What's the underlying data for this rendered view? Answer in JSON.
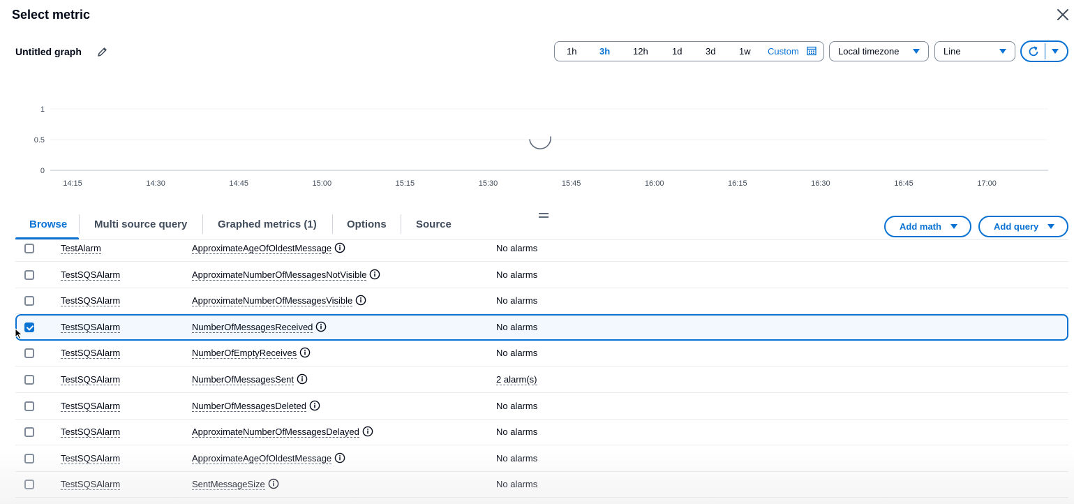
{
  "modal": {
    "title": "Select metric"
  },
  "graph": {
    "title": "Untitled graph"
  },
  "time_ranges": [
    {
      "label": "1h",
      "active": false
    },
    {
      "label": "3h",
      "active": true
    },
    {
      "label": "12h",
      "active": false
    },
    {
      "label": "1d",
      "active": false
    },
    {
      "label": "3d",
      "active": false
    },
    {
      "label": "1w",
      "active": false
    },
    {
      "label": "Custom",
      "active": false
    }
  ],
  "timezone_select": {
    "value": "Local timezone"
  },
  "graph_type_select": {
    "value": "Line"
  },
  "chart_data": {
    "type": "line",
    "y_ticks": [
      "1",
      "0.5",
      "0"
    ],
    "x_ticks": [
      "14:15",
      "14:30",
      "14:45",
      "15:00",
      "15:15",
      "15:30",
      "15:45",
      "16:00",
      "16:15",
      "16:30",
      "16:45",
      "17:00"
    ],
    "ylim": [
      0,
      1
    ],
    "series": [],
    "loading": true,
    "grid": true
  },
  "tabs": [
    {
      "label": "Browse",
      "active": true
    },
    {
      "label": "Multi source query",
      "active": false
    },
    {
      "label": "Graphed metrics (1)",
      "active": false
    },
    {
      "label": "Options",
      "active": false
    },
    {
      "label": "Source",
      "active": false
    }
  ],
  "actions": {
    "add_math": "Add math",
    "add_query": "Add query"
  },
  "rows": [
    {
      "name": "TestAlarm",
      "metric": "ApproximateAgeOfOldestMessage",
      "alarms": "No alarms",
      "checked": false
    },
    {
      "name": "TestSQSAlarm",
      "metric": "ApproximateNumberOfMessagesNotVisible",
      "alarms": "No alarms",
      "checked": false
    },
    {
      "name": "TestSQSAlarm",
      "metric": "ApproximateNumberOfMessagesVisible",
      "alarms": "No alarms",
      "checked": false
    },
    {
      "name": "TestSQSAlarm",
      "metric": "NumberOfMessagesReceived",
      "alarms": "No alarms",
      "checked": true
    },
    {
      "name": "TestSQSAlarm",
      "metric": "NumberOfEmptyReceives",
      "alarms": "No alarms",
      "checked": false
    },
    {
      "name": "TestSQSAlarm",
      "metric": "NumberOfMessagesSent",
      "alarms": "2 alarm(s)",
      "checked": false
    },
    {
      "name": "TestSQSAlarm",
      "metric": "NumberOfMessagesDeleted",
      "alarms": "No alarms",
      "checked": false
    },
    {
      "name": "TestSQSAlarm",
      "metric": "ApproximateNumberOfMessagesDelayed",
      "alarms": "No alarms",
      "checked": false
    },
    {
      "name": "TestSQSAlarm",
      "metric": "ApproximateAgeOfOldestMessage",
      "alarms": "No alarms",
      "checked": false
    },
    {
      "name": "TestSQSAlarm",
      "metric": "SentMessageSize",
      "alarms": "No alarms",
      "checked": false
    }
  ],
  "colors": {
    "accent": "#0972d3",
    "text": "#000716",
    "muted": "#5f6b7a",
    "border": "#7d8998"
  }
}
